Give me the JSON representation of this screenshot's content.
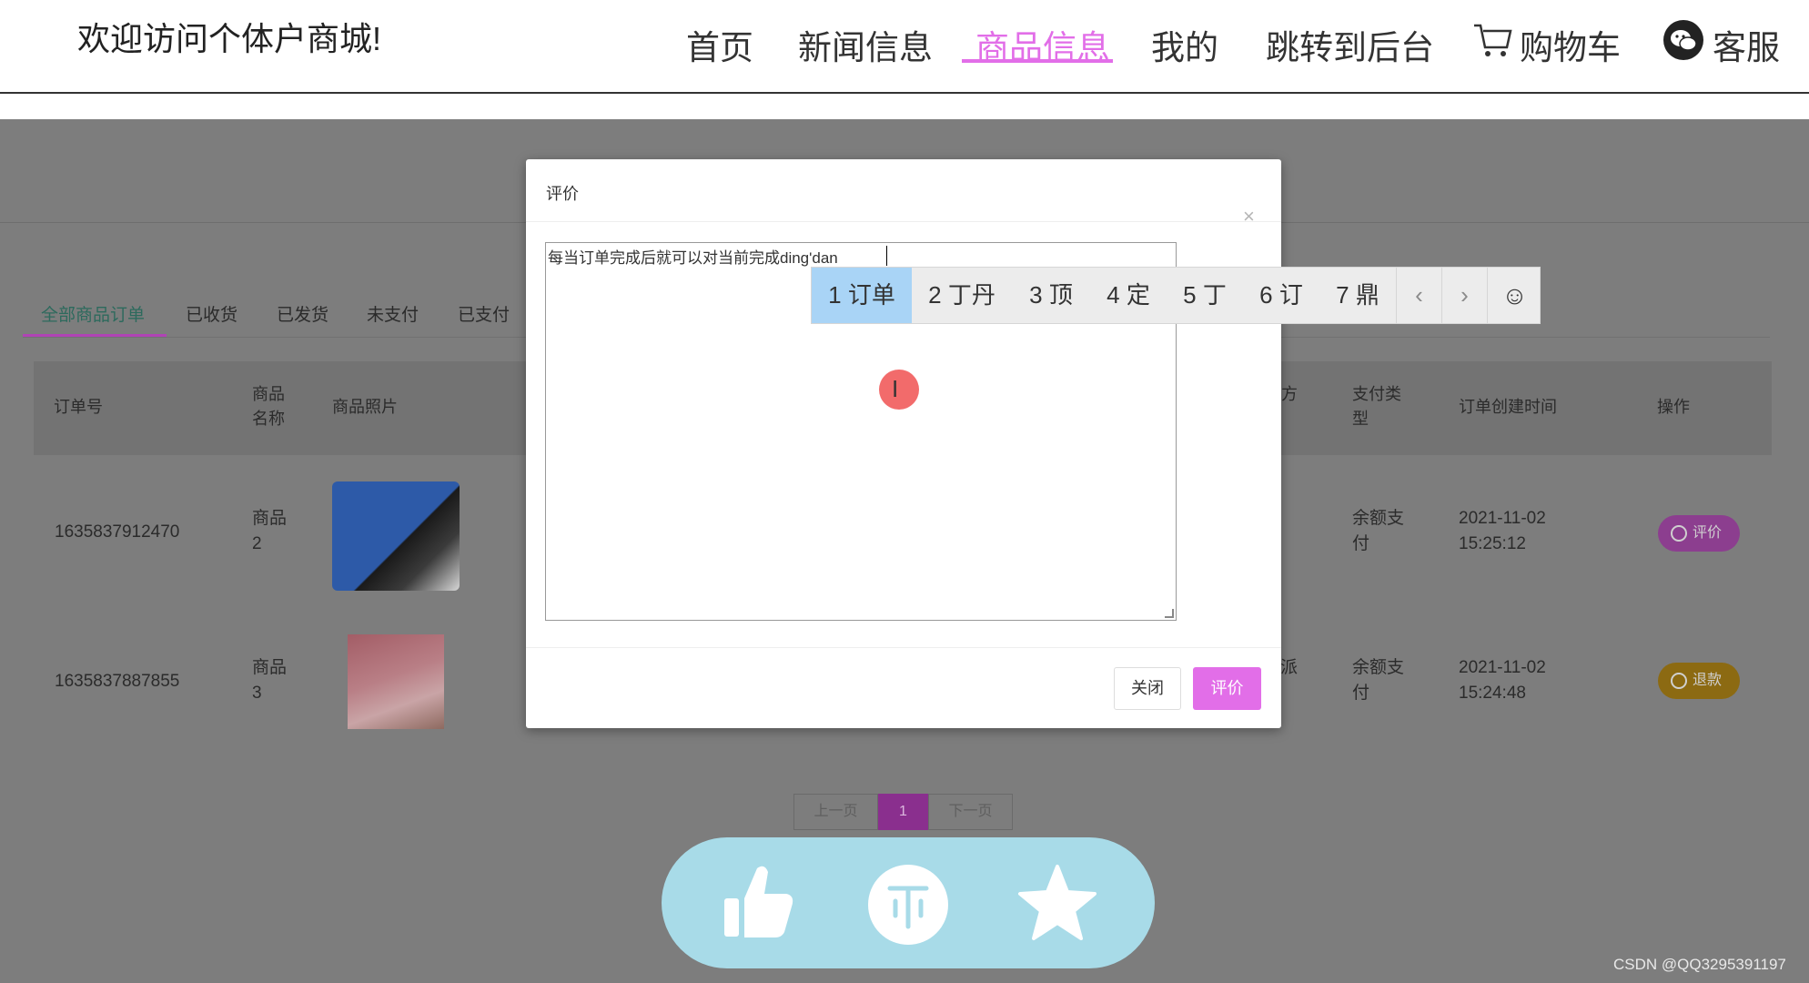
{
  "header": {
    "welcome": "欢迎访问个体户商城!",
    "nav": [
      "首页",
      "新闻信息",
      "商品信息",
      "我的",
      "跳转到后台",
      "购物车",
      "客服"
    ],
    "active_nav": "商品信息",
    "accent_color": "#e26ee8"
  },
  "orders": {
    "tabs": [
      "全部商品订单",
      "已收货",
      "已发货",
      "未支付",
      "已支付"
    ],
    "active_tab": "全部商品订单",
    "columns": [
      "订单号",
      "商品\n名称",
      "商品照片",
      "方",
      "支付类\n型",
      "订单创建时间",
      "操作"
    ],
    "rows": [
      {
        "order_no": "1635837912470",
        "product": "商品\n2",
        "delivery": "",
        "pay_type": "余额支\n付",
        "created": "2021-11-02\n15:25:12",
        "action": "评价"
      },
      {
        "order_no": "1635837887855",
        "product": "商品\n3",
        "delivery": "派",
        "pay_type": "余额支\n付",
        "created": "2021-11-02\n15:24:48",
        "action": "退款"
      }
    ],
    "pager": {
      "prev": "上一页",
      "current": "1",
      "next": "下一页"
    }
  },
  "modal": {
    "title": "评价",
    "close_symbol": "×",
    "textarea_value": "每当订单完成后就可以对当前完成ding'dan",
    "btn_close": "关闭",
    "btn_submit": "评价"
  },
  "ime": {
    "candidates": [
      "1 订单",
      "2 丁丹",
      "3 顶",
      "4 定",
      "5 丁",
      "6 订",
      "7 鼎"
    ],
    "selected_index": 0,
    "prev": "‹",
    "next": "›",
    "emoji": "☺"
  },
  "fab_icons": [
    "thumbs-up-icon",
    "coin-icon",
    "star-icon"
  ],
  "watermark": "CSDN @QQ3295391197"
}
